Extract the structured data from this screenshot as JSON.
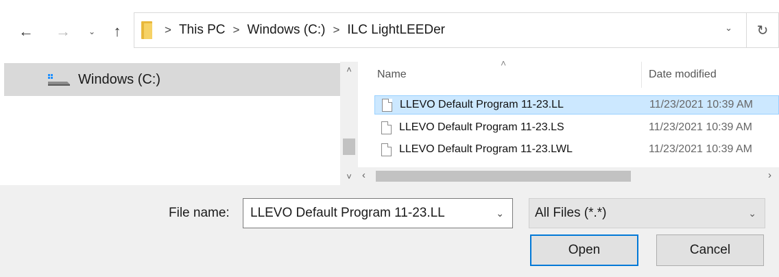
{
  "address_bar": {
    "crumbs": [
      "This PC",
      "Windows (C:)",
      "ILC LightLEEDer"
    ],
    "separator": ">"
  },
  "nav_icons": {
    "back": "arrow-left-icon",
    "forward": "arrow-right-icon",
    "recent": "chevron-down-icon",
    "up": "arrow-up-icon",
    "refresh": "refresh-icon"
  },
  "navigation_pane": {
    "items": [
      {
        "label": "Windows (C:)",
        "icon": "drive-icon",
        "selected": true
      }
    ]
  },
  "file_list": {
    "columns": [
      "Name",
      "Date modified"
    ],
    "files": [
      {
        "name": "LLEVO Default Program 11-23.LL",
        "date": "11/23/2021 10:39 AM",
        "selected": true
      },
      {
        "name": "LLEVO Default Program 11-23.LS",
        "date": "11/23/2021 10:39 AM",
        "selected": false
      },
      {
        "name": "LLEVO Default Program 11-23.LWL",
        "date": "11/23/2021 10:39 AM",
        "selected": false
      }
    ]
  },
  "bottom": {
    "file_name_label": "File name:",
    "file_name_value": "LLEVO Default Program 11-23.LL",
    "file_type": "All Files (*.*)",
    "open_label": "Open",
    "cancel_label": "Cancel"
  },
  "colors": {
    "selection_bg": "#cce8ff",
    "selection_border": "#99d1ff",
    "nav_selection_bg": "#d9d9d9",
    "default_button_border": "#0078d7",
    "panel_bg": "#f0f0f0"
  }
}
